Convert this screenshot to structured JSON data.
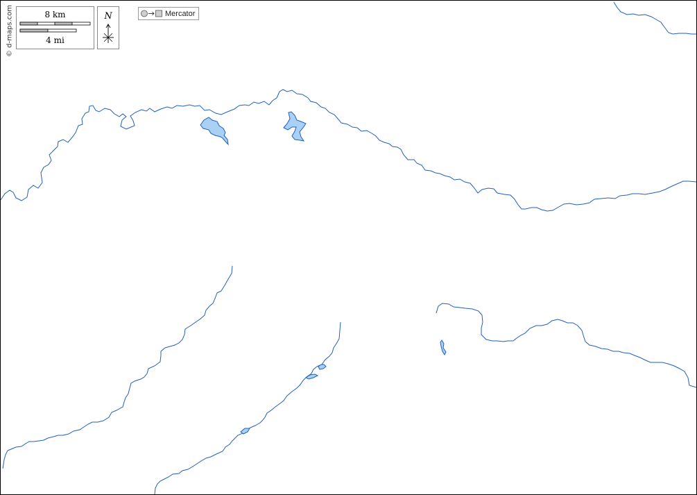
{
  "map": {
    "copyright": "© d-maps.com",
    "projection": {
      "icon": "globe-to-rectangle-icon",
      "label": "Mercator"
    },
    "scale": {
      "km_label": "8 km",
      "mi_label": "4 mi"
    },
    "north_arrow": {
      "letter": "N",
      "icon": "compass-star-icon"
    },
    "colors": {
      "background": "#ffffff",
      "river_stroke": "#1f5fbf",
      "lake_fill": "#a8d1f5",
      "lake_stroke": "#1f5fbf",
      "frame": "#000000"
    },
    "features": {
      "rivers": [
        "north-river",
        "northeast-stream",
        "southwest-river",
        "south-river",
        "east-river"
      ],
      "lakes": [
        "north-lake-west",
        "north-lake-east",
        "south-pond-small",
        "south-pond-middle",
        "east-pond-narrow",
        "south-pond-lower"
      ]
    }
  }
}
